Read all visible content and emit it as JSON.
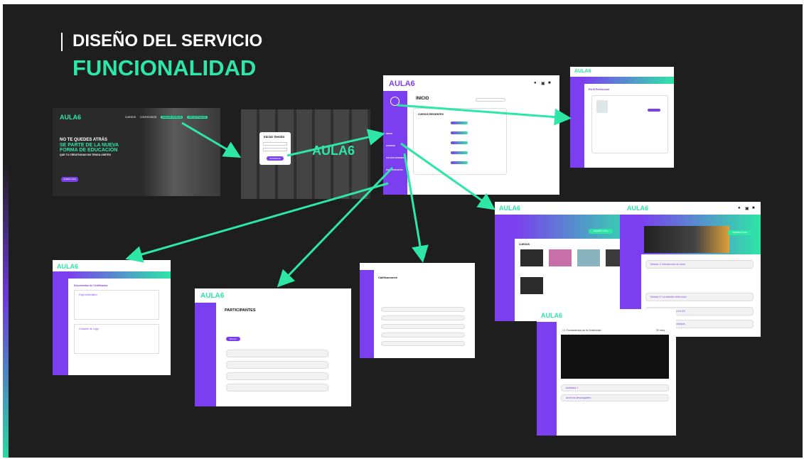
{
  "slide": {
    "title": "DISEÑO DEL SERVICIO",
    "subtitle": "FUNCIONALIDAD",
    "accent": "#2ee6a6",
    "brand": "#7b3ff0"
  },
  "logo": "AULA6",
  "landing": {
    "nav": [
      "CURSOS",
      "CONTENIDOS",
      "INICIAR SESION",
      "REGISTRARSE"
    ],
    "line1": "NO TE QUEDES ATRÁS",
    "line2": "SE PARTE DE LA NUEVA",
    "line3": "FORMA DE EDUCACIÓN",
    "line4": "QUE TU CREATIVIDAD NO TENGA LÍMITES",
    "cta": "SABER MÁS"
  },
  "login": {
    "title": "Iniciar Sesión",
    "button": "INGRESAR"
  },
  "inicio": {
    "title": "INICIO",
    "section": "CURSOS RECIENTES",
    "menu": [
      "INICIO",
      "CURSOS",
      "CALIFICACIONES",
      "PARTICIPANTES"
    ]
  },
  "perfil": {
    "title": "Perfil Profesional"
  },
  "cursos": {
    "badge": "DISEÑO UX/UI",
    "section": "CURSOS"
  },
  "modulos": {
    "badge": "DISEÑO UX/UI",
    "items": [
      "Módulo 1: Introducción al curso",
      "Módulo 2: La relación entre ux/ui",
      "Módulo 3: La creatividad en UX",
      "Módulo 4: Diseño de prototipos"
    ]
  },
  "video": {
    "title": "1.1 Fundamentos de la Creatividad",
    "duration": "20 mins",
    "rows": [
      "Actividad 1",
      "Archivos descargables"
    ]
  },
  "calificaciones": {
    "title": "Calificaciones"
  },
  "participantes": {
    "title": "PARTICIPANTES",
    "button": "Buscar"
  },
  "certificados": {
    "title": "Documentos de Certificados",
    "item1": "Flujo Informativo",
    "item2": "Creación de Logo"
  }
}
